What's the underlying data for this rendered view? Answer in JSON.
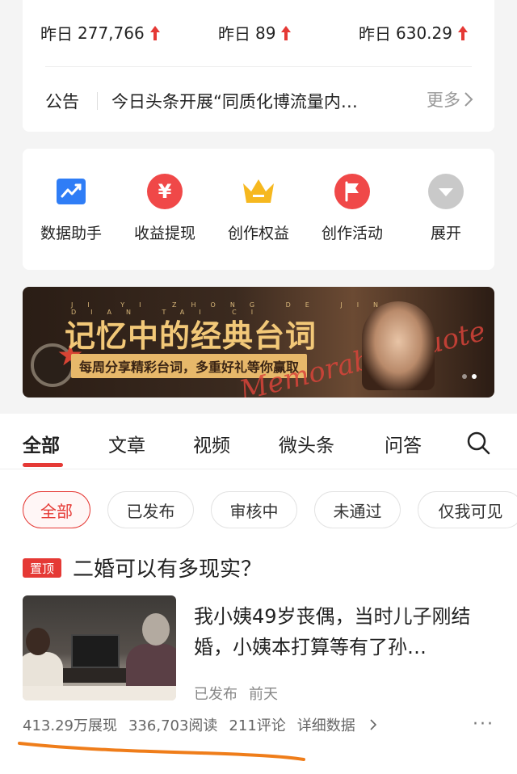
{
  "stats": [
    {
      "label": "昨日",
      "value": "277,766"
    },
    {
      "label": "昨日",
      "value": "89"
    },
    {
      "label": "昨日",
      "value": "630.29"
    }
  ],
  "notice": {
    "label": "公告",
    "text": "今日头条开展“同质化博流量内…",
    "more": "更多"
  },
  "tools": [
    {
      "label": "数据助手",
      "icon": "chart-icon"
    },
    {
      "label": "收益提现",
      "icon": "yuan-icon"
    },
    {
      "label": "创作权益",
      "icon": "crown-icon"
    },
    {
      "label": "创作活动",
      "icon": "flag-icon"
    },
    {
      "label": "展开",
      "icon": "chevron-down-icon"
    }
  ],
  "banner": {
    "pinyin": "JI YI ZHONG DE JING DIAN TAI CI",
    "title": "记忆中的经典台词",
    "subtitle": "每周分享精彩台词，多重好礼等你赢取",
    "script": "Memorable Quote"
  },
  "tabs": [
    "全部",
    "文章",
    "视频",
    "微头条",
    "问答"
  ],
  "filters": [
    "全部",
    "已发布",
    "审核中",
    "未通过",
    "仅我可见"
  ],
  "article": {
    "pin_tag": "置顶",
    "title": "二婚可以有多现实？",
    "snippet": "我小姨49岁丧偶，当时儿子刚结婚，小姨本打算等有了孙…",
    "status": "已发布",
    "time": "前天",
    "impressions": "413.29万展现",
    "reads": "336,703阅读",
    "comments": "211评论",
    "detail": "详细数据"
  },
  "colors": {
    "accent_red": "#e53935",
    "up_arrow": "#e53935",
    "annotation_orange": "#ef7d1a"
  }
}
